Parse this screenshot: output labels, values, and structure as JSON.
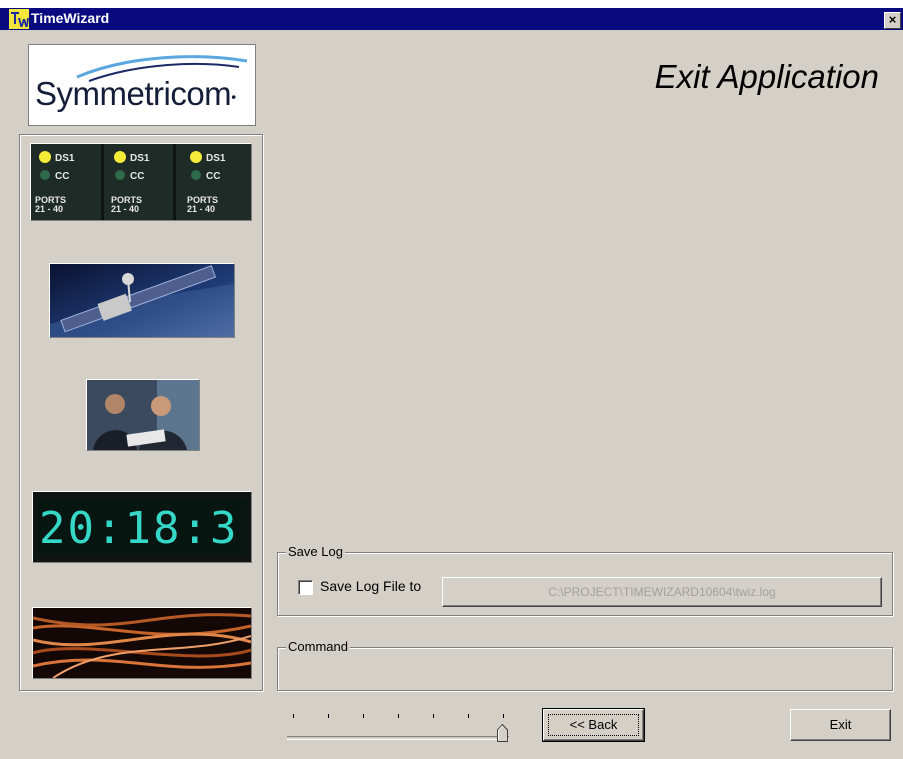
{
  "window": {
    "title": "TimeWizard",
    "close_glyph": "×"
  },
  "branding": {
    "logo_text": "Symmetricom",
    "logo_registered": "•"
  },
  "heading": "Exit Application",
  "side_images": {
    "ds1_panel": [
      {
        "led1": "DS1",
        "led2": "CC",
        "ports1": "PORTS",
        "ports2": "21 - 40"
      },
      {
        "led1": "DS1",
        "led2": "CC",
        "ports1": "PORTS",
        "ports2": "21 - 40"
      },
      {
        "led1": "DS1",
        "led2": "CC",
        "ports1": "PORTS",
        "ports2": "21 - 40"
      }
    ],
    "clock_digits": "20:18:3"
  },
  "save_log": {
    "legend": "Save Log",
    "checkbox_label": "Save Log File to",
    "checked": false,
    "path": "C:\\PROJECT\\TIMEWIZARD10604\\twiz.log"
  },
  "command": {
    "legend": "Command",
    "text": ""
  },
  "wizard_progress": {
    "tick_count": 8,
    "position": 8
  },
  "buttons": {
    "back": "<< Back",
    "exit": "Exit"
  },
  "colors": {
    "title_bar": "#0a0a80",
    "face": "#d4d0c8",
    "led_yellow": "#f5ec3a",
    "clock_cyan": "#35d7c6"
  }
}
